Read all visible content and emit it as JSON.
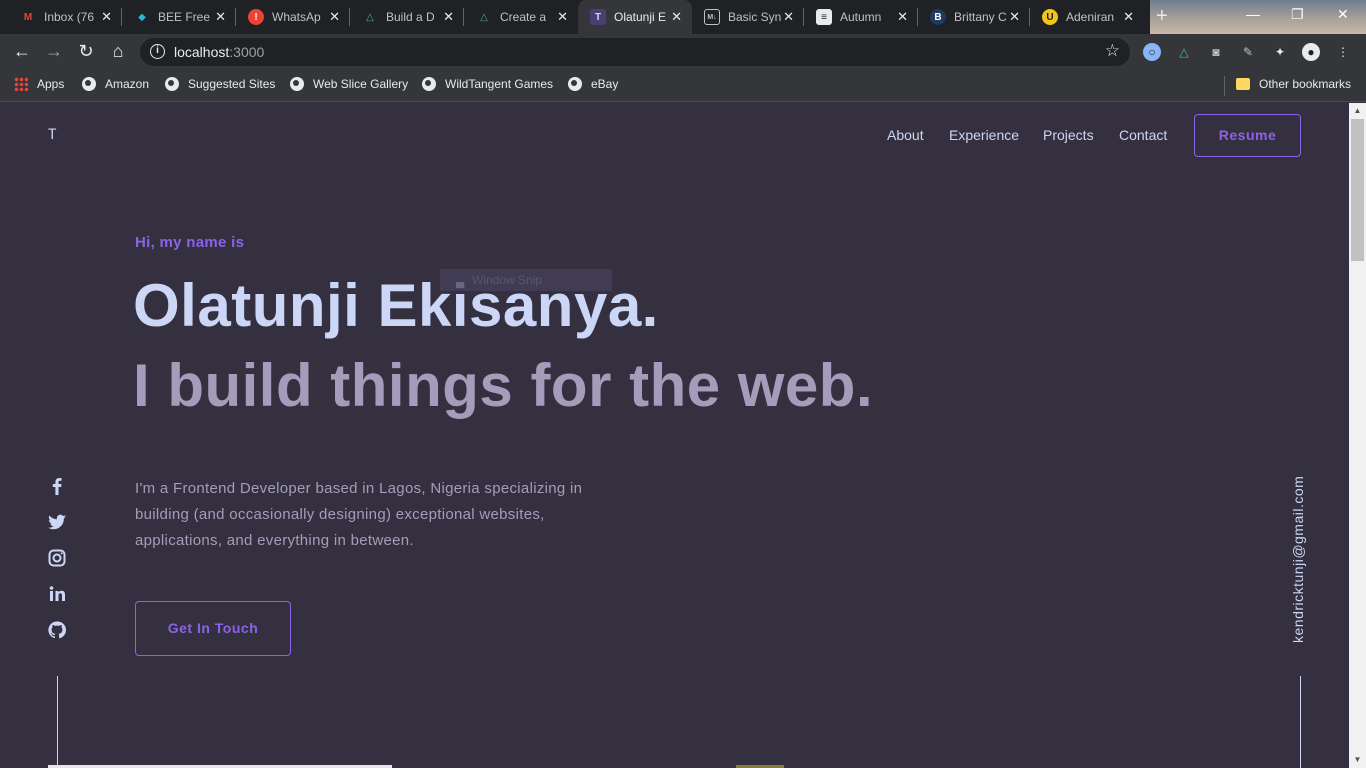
{
  "browser": {
    "tabs": [
      {
        "title": "Inbox (76",
        "icon": "gmail-icon",
        "icon_color": "#ea4335",
        "glyph": "M"
      },
      {
        "title": "BEE Free",
        "icon": "bee-icon",
        "icon_color": "#2bb5d8",
        "glyph": "B"
      },
      {
        "title": "WhatsAp",
        "icon": "whatsapp-alert-icon",
        "icon_color": "#ea4335",
        "glyph": "!"
      },
      {
        "title": "Build a D",
        "icon": "vue-icon",
        "icon_color": "#41b883",
        "glyph": "▲"
      },
      {
        "title": "Create a",
        "icon": "vue-icon",
        "icon_color": "#41b883",
        "glyph": "▲"
      },
      {
        "title": "Olatunji E",
        "icon": "portfolio-icon",
        "icon_color": "#4b3f72",
        "glyph": "T"
      },
      {
        "title": "Basic Syn",
        "icon": "markdown-icon",
        "icon_color": "#5f6368",
        "glyph": "M↓"
      },
      {
        "title": "Autumn",
        "icon": "document-icon",
        "icon_color": "#e8eaed",
        "glyph": "≡"
      },
      {
        "title": "Brittany C",
        "icon": "brittany-icon",
        "icon_color": "#1e3a5f",
        "glyph": "B"
      },
      {
        "title": "Adeniran",
        "icon": "adeniran-icon",
        "icon_color": "#f0c419",
        "glyph": "U"
      }
    ],
    "url_host": "localhost",
    "url_port": ":3000",
    "bookmarks": [
      {
        "label": "Apps"
      },
      {
        "label": "Amazon"
      },
      {
        "label": "Suggested Sites"
      },
      {
        "label": "Web Slice Gallery"
      },
      {
        "label": "WildTangent Games"
      },
      {
        "label": "eBay"
      }
    ],
    "other_bookmarks": "Other bookmarks"
  },
  "site": {
    "logo": "T",
    "nav": [
      "About",
      "Experience",
      "Projects",
      "Contact"
    ],
    "resume": "Resume",
    "intro": "Hi, my name is",
    "name": "Olatunji Ekisanya.",
    "tagline": "I build things for the web.",
    "bio": "I'm a Frontend Developer based in Lagos, Nigeria specializing in building (and occasionally designing) exceptional websites, applications, and everything in between.",
    "cta": "Get In Touch",
    "email": "kendricktunji@gmail.com",
    "snip_overlay": "Window Snip",
    "socials": [
      "facebook-icon",
      "twitter-icon",
      "instagram-icon",
      "linkedin-icon",
      "github-icon"
    ]
  },
  "colors": {
    "background": "#35303f",
    "accent": "#8a63e8",
    "heading": "#ccd6f6",
    "muted": "#a39dbb"
  }
}
